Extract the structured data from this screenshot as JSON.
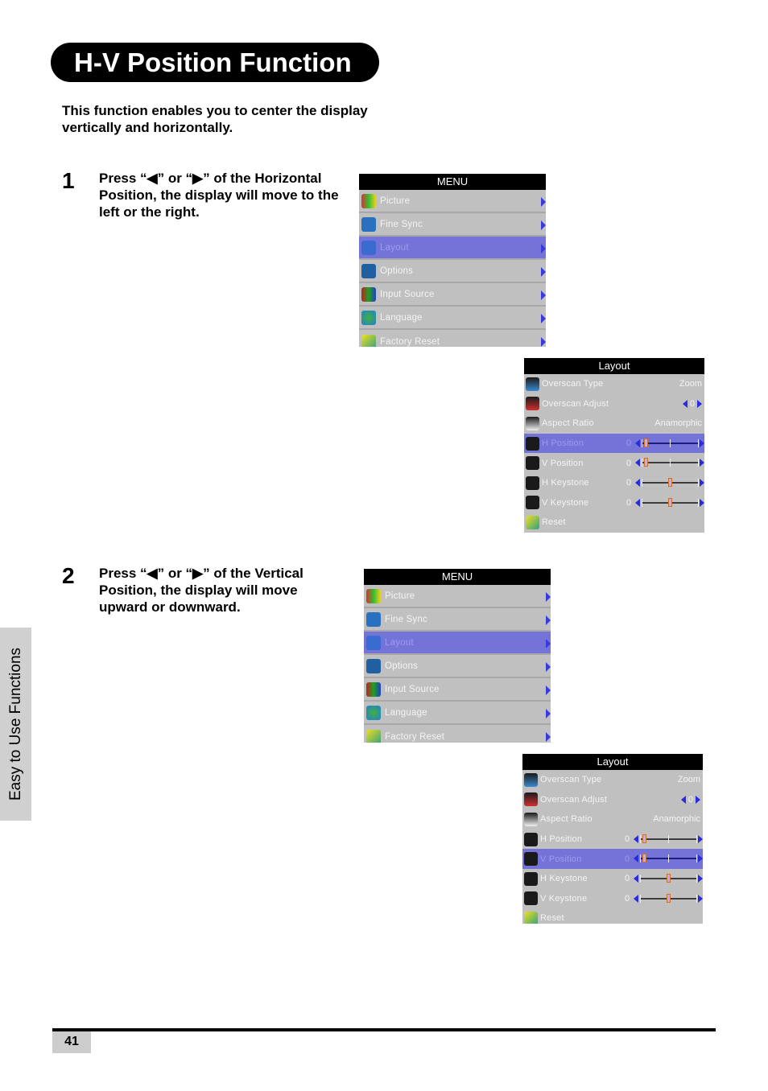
{
  "page": {
    "title": "H-V Position Function",
    "intro": "This function enables you to center the display vertically and horizontally.",
    "side_tab": "Easy to Use Functions",
    "page_number": "41"
  },
  "steps": [
    {
      "number": "1",
      "text": "Press “◀” or “▶” of the Horizontal Position, the display will move to the left or the right."
    },
    {
      "number": "2",
      "text": "Press “◀” or “▶” of the Vertical Position, the display will move upward or downward."
    }
  ],
  "colors": {
    "osd_background": "#c0c0c0",
    "osd_header": "#000000",
    "osd_selected": "#7474d8",
    "osd_arrow": "#3a3adc"
  },
  "main_menu": {
    "header": "MENU",
    "selected_index": 2,
    "items": [
      {
        "label": "Picture",
        "icon": "picture-icon"
      },
      {
        "label": "Fine Sync",
        "icon": "fine-sync-icon"
      },
      {
        "label": "Layout",
        "icon": "layout-icon"
      },
      {
        "label": "Options",
        "icon": "options-icon"
      },
      {
        "label": "Input Source",
        "icon": "input-source-icon"
      },
      {
        "label": "Language",
        "icon": "language-icon"
      },
      {
        "label": "Factory Reset",
        "icon": "factory-reset-icon"
      }
    ]
  },
  "layout_menu": {
    "header": "Layout",
    "items": [
      {
        "label": "Overscan Type",
        "icon": "overscan-type-icon",
        "value": "Zoom"
      },
      {
        "label": "Overscan Adjust",
        "icon": "overscan-adjust-icon",
        "value": "0"
      },
      {
        "label": "Aspect Ratio",
        "icon": "aspect-ratio-icon",
        "value": "Anamorphic"
      },
      {
        "label": "H Position",
        "icon": "h-position-icon",
        "value": "0",
        "slider_position": 0.05
      },
      {
        "label": "V Position",
        "icon": "v-position-icon",
        "value": "0",
        "slider_position": 0.05
      },
      {
        "label": "H Keystone",
        "icon": "h-keystone-icon",
        "value": "0",
        "slider_position": 0.5
      },
      {
        "label": "V Keystone",
        "icon": "v-keystone-icon",
        "value": "0",
        "slider_position": 0.5
      },
      {
        "label": "Reset",
        "icon": "reset-icon"
      }
    ]
  },
  "screens": [
    {
      "menu_selected": "Layout",
      "layout_selected": "H Position"
    },
    {
      "menu_selected": "Layout",
      "layout_selected": "V Position"
    }
  ]
}
